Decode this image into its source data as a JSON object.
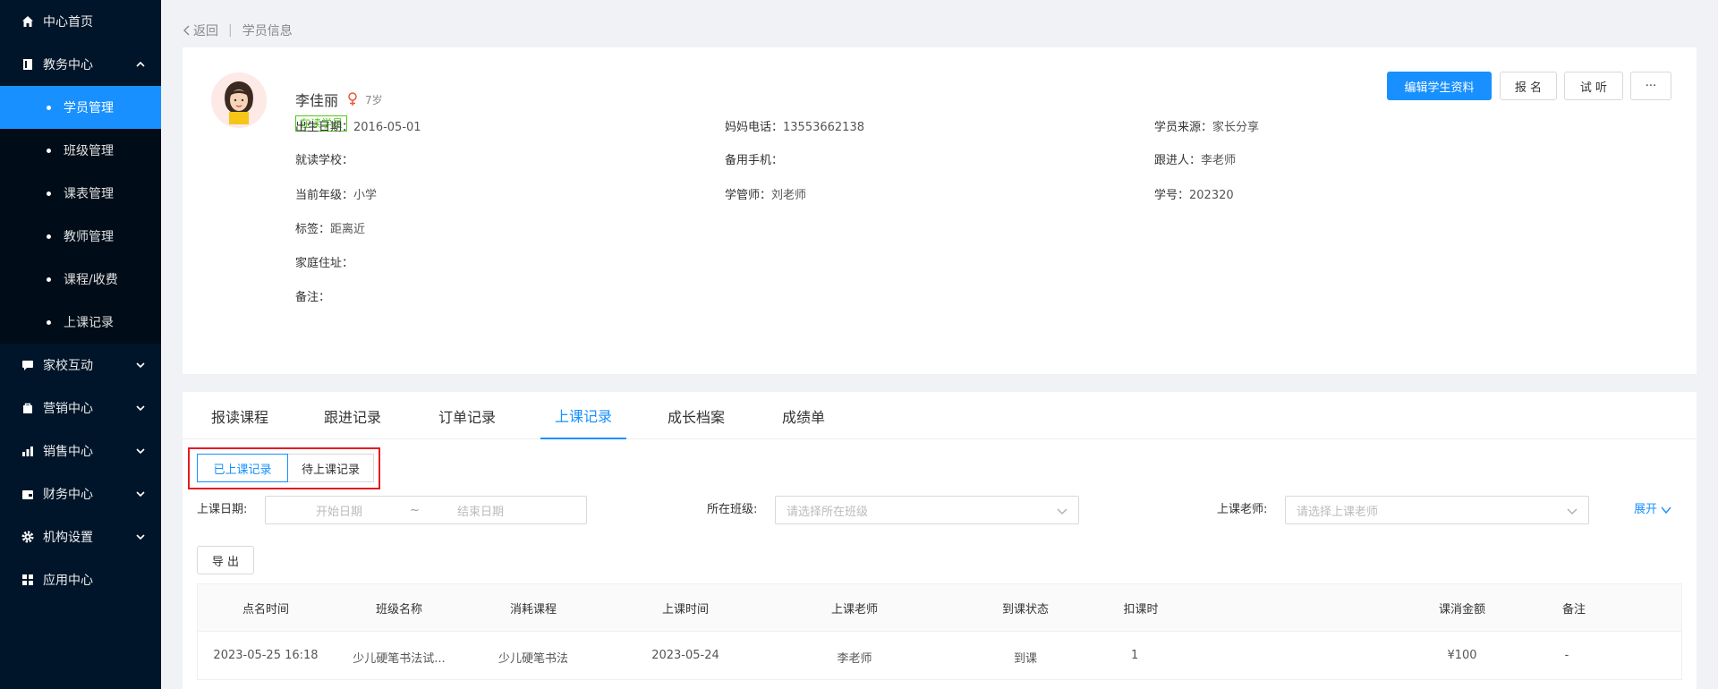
{
  "sidebar": {
    "items": [
      {
        "label": "中心首页",
        "icon": "home-icon"
      },
      {
        "label": "教务中心",
        "icon": "book-icon",
        "expanded": true
      },
      {
        "label": "家校互动",
        "icon": "chat-icon"
      },
      {
        "label": "营销中心",
        "icon": "bag-icon"
      },
      {
        "label": "销售中心",
        "icon": "chart-icon"
      },
      {
        "label": "财务中心",
        "icon": "wallet-icon"
      },
      {
        "label": "机构设置",
        "icon": "gear-icon"
      },
      {
        "label": "应用中心",
        "icon": "grid-icon"
      }
    ],
    "sub_items": [
      {
        "label": "学员管理",
        "active": true
      },
      {
        "label": "班级管理"
      },
      {
        "label": "课表管理"
      },
      {
        "label": "教师管理"
      },
      {
        "label": "课程/收费"
      },
      {
        "label": "上课记录"
      }
    ]
  },
  "breadcrumb": {
    "back": "返回",
    "current": "学员信息"
  },
  "student": {
    "name": "李佳丽",
    "age": "7岁",
    "status": "在读学员",
    "fields": {
      "birth_label": "出生日期：",
      "birth": "2016-05-01",
      "school_label": "就读学校：",
      "school": "",
      "grade_label": "当前年级：",
      "grade": "小学",
      "tag_label": "标签：",
      "tag": "距离近",
      "address_label": "家庭住址：",
      "address": "",
      "note_label": "备注：",
      "note": "",
      "mother_phone_label": "妈妈电话：",
      "mother_phone": "13553662138",
      "backup_phone_label": "备用手机：",
      "backup_phone": "",
      "manager_label": "学管师：",
      "manager": "刘老师",
      "source_label": "学员来源：",
      "source": "家长分享",
      "follower_label": "跟进人：",
      "follower": "李老师",
      "student_no_label": "学号：",
      "student_no": "202320"
    }
  },
  "actions": {
    "edit": "编辑学生资料",
    "enroll": "报 名",
    "trial": "试 听",
    "more": "···"
  },
  "tabs": [
    "报读课程",
    "跟进记录",
    "订单记录",
    "上课记录",
    "成长档案",
    "成绩单"
  ],
  "active_tab": "上课记录",
  "segments": {
    "done": "已上课记录",
    "pending": "待上课记录"
  },
  "filters": {
    "date_label": "上课日期:",
    "start_placeholder": "开始日期",
    "range_sep": "~",
    "end_placeholder": "结束日期",
    "class_label": "所在班级:",
    "class_placeholder": "请选择所在班级",
    "teacher_label": "上课老师:",
    "teacher_placeholder": "请选择上课老师",
    "expand": "展开"
  },
  "export_label": "导 出",
  "table": {
    "headers": [
      "点名时间",
      "班级名称",
      "消耗课程",
      "上课时间",
      "上课老师",
      "到课状态",
      "扣课时",
      "课消金额",
      "备注"
    ],
    "rows": [
      [
        "2023-05-25 16:18",
        "少儿硬笔书法试...",
        "少儿硬笔书法",
        "2023-05-24",
        "李老师",
        "到课",
        "1",
        "¥100",
        "-"
      ]
    ]
  },
  "colors": {
    "primary": "#1890ff",
    "sidebar_bg": "#001529",
    "highlight": "#e51c23",
    "status_green": "#52c41a"
  }
}
